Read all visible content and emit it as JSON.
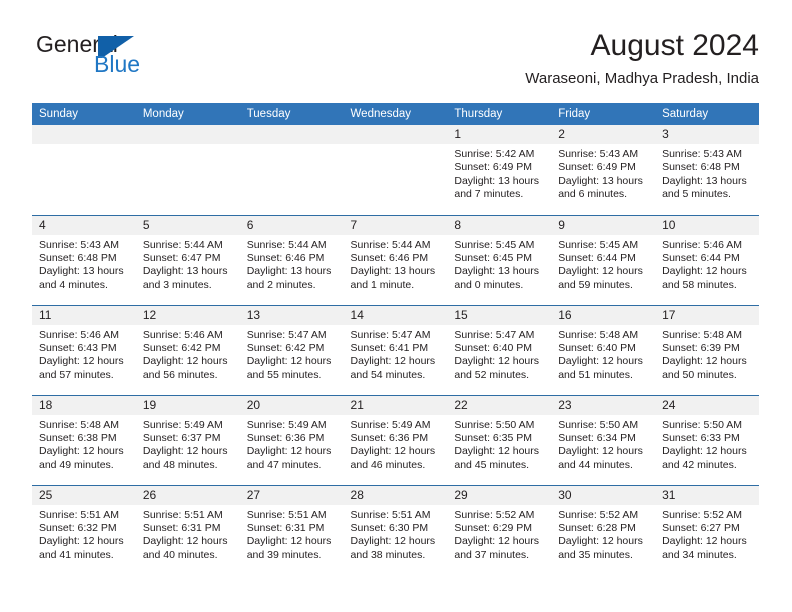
{
  "brand": {
    "name_part1": "General",
    "name_part2": "Blue",
    "logo_icon": "triangle-logo-icon"
  },
  "header": {
    "month_title": "August 2024",
    "location": "Waraseoni, Madhya Pradesh, India"
  },
  "colors": {
    "header_bar": "#3175b8",
    "daynum_band": "#f1f1f1",
    "row_divider": "#2e6da4",
    "brand_blue": "#1160a8",
    "text": "#231f20"
  },
  "weekday_headers": [
    "Sunday",
    "Monday",
    "Tuesday",
    "Wednesday",
    "Thursday",
    "Friday",
    "Saturday"
  ],
  "weeks": [
    [
      {
        "day": "",
        "blank": true
      },
      {
        "day": "",
        "blank": true
      },
      {
        "day": "",
        "blank": true
      },
      {
        "day": "",
        "blank": true
      },
      {
        "day": "1",
        "sunrise": "Sunrise: 5:42 AM",
        "sunset": "Sunset: 6:49 PM",
        "daylight": "Daylight: 13 hours and 7 minutes."
      },
      {
        "day": "2",
        "sunrise": "Sunrise: 5:43 AM",
        "sunset": "Sunset: 6:49 PM",
        "daylight": "Daylight: 13 hours and 6 minutes."
      },
      {
        "day": "3",
        "sunrise": "Sunrise: 5:43 AM",
        "sunset": "Sunset: 6:48 PM",
        "daylight": "Daylight: 13 hours and 5 minutes."
      }
    ],
    [
      {
        "day": "4",
        "sunrise": "Sunrise: 5:43 AM",
        "sunset": "Sunset: 6:48 PM",
        "daylight": "Daylight: 13 hours and 4 minutes."
      },
      {
        "day": "5",
        "sunrise": "Sunrise: 5:44 AM",
        "sunset": "Sunset: 6:47 PM",
        "daylight": "Daylight: 13 hours and 3 minutes."
      },
      {
        "day": "6",
        "sunrise": "Sunrise: 5:44 AM",
        "sunset": "Sunset: 6:46 PM",
        "daylight": "Daylight: 13 hours and 2 minutes."
      },
      {
        "day": "7",
        "sunrise": "Sunrise: 5:44 AM",
        "sunset": "Sunset: 6:46 PM",
        "daylight": "Daylight: 13 hours and 1 minute."
      },
      {
        "day": "8",
        "sunrise": "Sunrise: 5:45 AM",
        "sunset": "Sunset: 6:45 PM",
        "daylight": "Daylight: 13 hours and 0 minutes."
      },
      {
        "day": "9",
        "sunrise": "Sunrise: 5:45 AM",
        "sunset": "Sunset: 6:44 PM",
        "daylight": "Daylight: 12 hours and 59 minutes."
      },
      {
        "day": "10",
        "sunrise": "Sunrise: 5:46 AM",
        "sunset": "Sunset: 6:44 PM",
        "daylight": "Daylight: 12 hours and 58 minutes."
      }
    ],
    [
      {
        "day": "11",
        "sunrise": "Sunrise: 5:46 AM",
        "sunset": "Sunset: 6:43 PM",
        "daylight": "Daylight: 12 hours and 57 minutes."
      },
      {
        "day": "12",
        "sunrise": "Sunrise: 5:46 AM",
        "sunset": "Sunset: 6:42 PM",
        "daylight": "Daylight: 12 hours and 56 minutes."
      },
      {
        "day": "13",
        "sunrise": "Sunrise: 5:47 AM",
        "sunset": "Sunset: 6:42 PM",
        "daylight": "Daylight: 12 hours and 55 minutes."
      },
      {
        "day": "14",
        "sunrise": "Sunrise: 5:47 AM",
        "sunset": "Sunset: 6:41 PM",
        "daylight": "Daylight: 12 hours and 54 minutes."
      },
      {
        "day": "15",
        "sunrise": "Sunrise: 5:47 AM",
        "sunset": "Sunset: 6:40 PM",
        "daylight": "Daylight: 12 hours and 52 minutes."
      },
      {
        "day": "16",
        "sunrise": "Sunrise: 5:48 AM",
        "sunset": "Sunset: 6:40 PM",
        "daylight": "Daylight: 12 hours and 51 minutes."
      },
      {
        "day": "17",
        "sunrise": "Sunrise: 5:48 AM",
        "sunset": "Sunset: 6:39 PM",
        "daylight": "Daylight: 12 hours and 50 minutes."
      }
    ],
    [
      {
        "day": "18",
        "sunrise": "Sunrise: 5:48 AM",
        "sunset": "Sunset: 6:38 PM",
        "daylight": "Daylight: 12 hours and 49 minutes."
      },
      {
        "day": "19",
        "sunrise": "Sunrise: 5:49 AM",
        "sunset": "Sunset: 6:37 PM",
        "daylight": "Daylight: 12 hours and 48 minutes."
      },
      {
        "day": "20",
        "sunrise": "Sunrise: 5:49 AM",
        "sunset": "Sunset: 6:36 PM",
        "daylight": "Daylight: 12 hours and 47 minutes."
      },
      {
        "day": "21",
        "sunrise": "Sunrise: 5:49 AM",
        "sunset": "Sunset: 6:36 PM",
        "daylight": "Daylight: 12 hours and 46 minutes."
      },
      {
        "day": "22",
        "sunrise": "Sunrise: 5:50 AM",
        "sunset": "Sunset: 6:35 PM",
        "daylight": "Daylight: 12 hours and 45 minutes."
      },
      {
        "day": "23",
        "sunrise": "Sunrise: 5:50 AM",
        "sunset": "Sunset: 6:34 PM",
        "daylight": "Daylight: 12 hours and 44 minutes."
      },
      {
        "day": "24",
        "sunrise": "Sunrise: 5:50 AM",
        "sunset": "Sunset: 6:33 PM",
        "daylight": "Daylight: 12 hours and 42 minutes."
      }
    ],
    [
      {
        "day": "25",
        "sunrise": "Sunrise: 5:51 AM",
        "sunset": "Sunset: 6:32 PM",
        "daylight": "Daylight: 12 hours and 41 minutes."
      },
      {
        "day": "26",
        "sunrise": "Sunrise: 5:51 AM",
        "sunset": "Sunset: 6:31 PM",
        "daylight": "Daylight: 12 hours and 40 minutes."
      },
      {
        "day": "27",
        "sunrise": "Sunrise: 5:51 AM",
        "sunset": "Sunset: 6:31 PM",
        "daylight": "Daylight: 12 hours and 39 minutes."
      },
      {
        "day": "28",
        "sunrise": "Sunrise: 5:51 AM",
        "sunset": "Sunset: 6:30 PM",
        "daylight": "Daylight: 12 hours and 38 minutes."
      },
      {
        "day": "29",
        "sunrise": "Sunrise: 5:52 AM",
        "sunset": "Sunset: 6:29 PM",
        "daylight": "Daylight: 12 hours and 37 minutes."
      },
      {
        "day": "30",
        "sunrise": "Sunrise: 5:52 AM",
        "sunset": "Sunset: 6:28 PM",
        "daylight": "Daylight: 12 hours and 35 minutes."
      },
      {
        "day": "31",
        "sunrise": "Sunrise: 5:52 AM",
        "sunset": "Sunset: 6:27 PM",
        "daylight": "Daylight: 12 hours and 34 minutes."
      }
    ]
  ]
}
